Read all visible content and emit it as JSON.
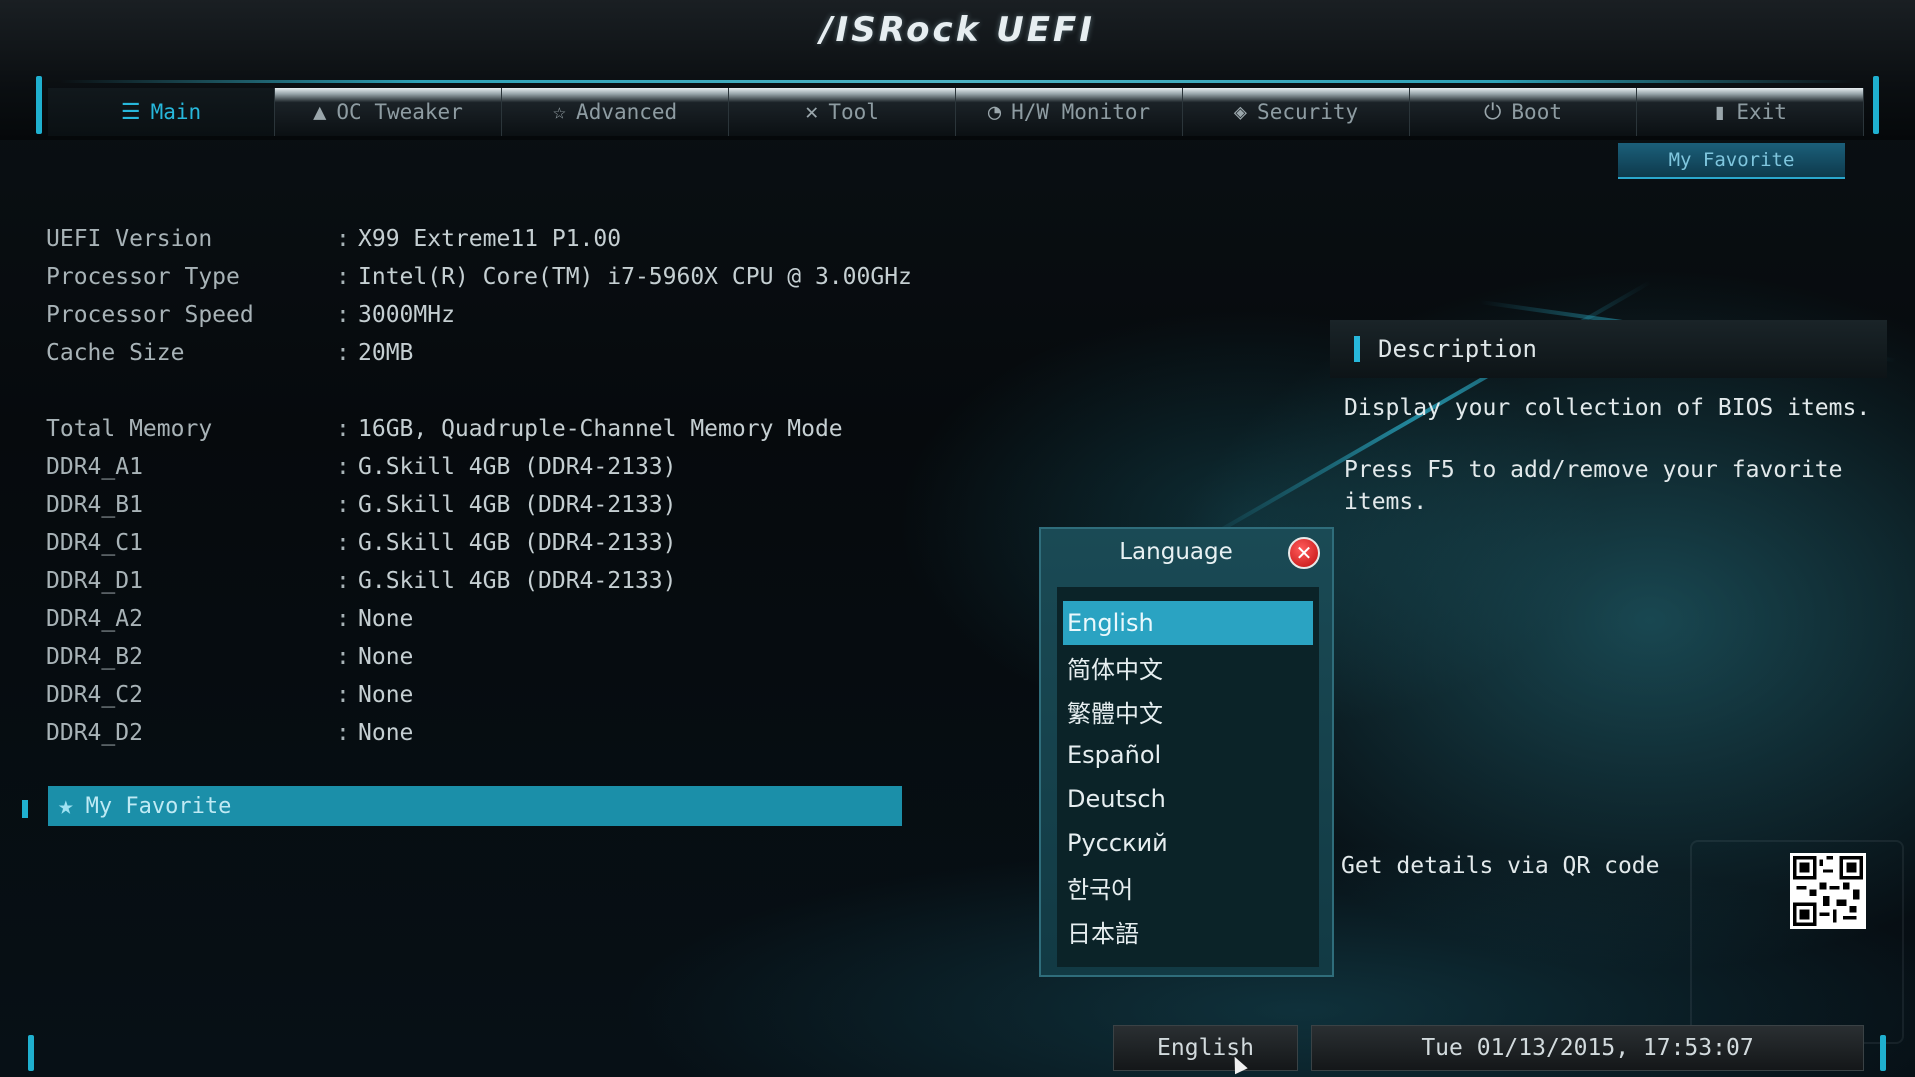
{
  "header": {
    "logo": "/ISRock UEFI",
    "my_favorite_button": "My Favorite"
  },
  "tabs": [
    {
      "label": "Main",
      "icon": "list-icon",
      "active": true
    },
    {
      "label": "OC Tweaker",
      "icon": "rocket-icon",
      "active": false
    },
    {
      "label": "Advanced",
      "icon": "star-icon",
      "active": false
    },
    {
      "label": "Tool",
      "icon": "tools-icon",
      "active": false
    },
    {
      "label": "H/W Monitor",
      "icon": "monitor-icon",
      "active": false
    },
    {
      "label": "Security",
      "icon": "shield-icon",
      "active": false
    },
    {
      "label": "Boot",
      "icon": "power-icon",
      "active": false
    },
    {
      "label": "Exit",
      "icon": "exit-icon",
      "active": false
    }
  ],
  "info": {
    "uefi_version": {
      "label": "UEFI Version",
      "value": "X99 Extreme11 P1.00"
    },
    "processor_type": {
      "label": "Processor Type",
      "value": "Intel(R) Core(TM) i7-5960X CPU @ 3.00GHz"
    },
    "processor_speed": {
      "label": "Processor Speed",
      "value": "3000MHz"
    },
    "cache_size": {
      "label": "Cache Size",
      "value": "20MB"
    },
    "total_memory": {
      "label": "Total Memory",
      "value": "16GB, Quadruple-Channel Memory Mode"
    },
    "ddr4_a1": {
      "label": "DDR4_A1",
      "value": "G.Skill 4GB (DDR4-2133)"
    },
    "ddr4_b1": {
      "label": "DDR4_B1",
      "value": "G.Skill 4GB (DDR4-2133)"
    },
    "ddr4_c1": {
      "label": "DDR4_C1",
      "value": "G.Skill 4GB (DDR4-2133)"
    },
    "ddr4_d1": {
      "label": "DDR4_D1",
      "value": "G.Skill 4GB (DDR4-2133)"
    },
    "ddr4_a2": {
      "label": "DDR4_A2",
      "value": "None"
    },
    "ddr4_b2": {
      "label": "DDR4_B2",
      "value": "None"
    },
    "ddr4_c2": {
      "label": "DDR4_C2",
      "value": "None"
    },
    "ddr4_d2": {
      "label": "DDR4_D2",
      "value": "None"
    },
    "separator": ":"
  },
  "favorite_item": "My Favorite",
  "description": {
    "title": "Description",
    "line1": "Display your collection of BIOS items.",
    "line2": "Press F5 to add/remove your favorite items.",
    "qr_text": "Get details via QR code"
  },
  "language_dialog": {
    "title": "Language",
    "selected": "English",
    "options": [
      "English",
      "简体中文",
      "繁體中文",
      "Español",
      "Deutsch",
      "Русский",
      "한국어",
      "日本語"
    ]
  },
  "footer": {
    "language": "English",
    "datetime": "Tue 01/13/2015, 17:53:07"
  },
  "colors": {
    "accent": "#27b8dc",
    "selection": "#2aa3c2",
    "favorite_bar": "#1b8fa9",
    "close": "#d41a1a"
  }
}
